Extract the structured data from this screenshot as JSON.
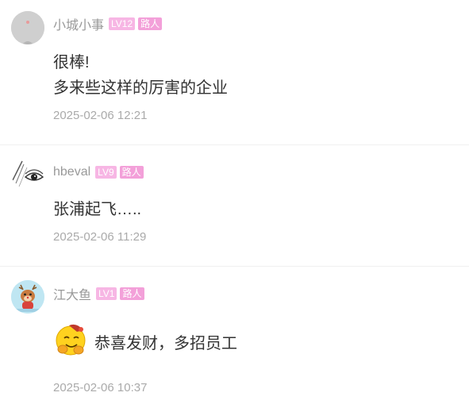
{
  "comments": [
    {
      "username": "小城小事",
      "level": "LV12",
      "role": "路人",
      "lines": [
        "很棒!",
        "多来些这样的厉害的企业"
      ],
      "time": "2025-02-06 12:21",
      "avatar_icon": "gray-dot-avatar"
    },
    {
      "username": "hbeval",
      "level": "LV9",
      "role": "路人",
      "lines": [
        "张浦起飞….."
      ],
      "time": "2025-02-06 11:29",
      "avatar_icon": "eye-sketch-avatar"
    },
    {
      "username": "江大鱼",
      "level": "LV1",
      "role": "路人",
      "lines": [
        "恭喜发财，多招员工"
      ],
      "time": "2025-02-06 10:37",
      "avatar_icon": "deer-cartoon-avatar",
      "emoji_icon": "yellow-blessing-emoji"
    }
  ],
  "colors": {
    "badge_bg": "#f7b6e4",
    "username": "#999999",
    "body_text": "#333333",
    "time": "#aaaaaa"
  }
}
